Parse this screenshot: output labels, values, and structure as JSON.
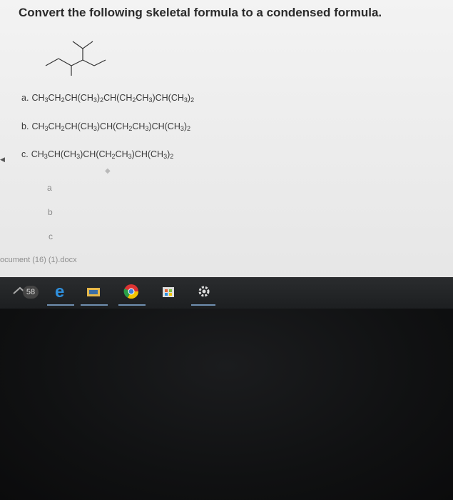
{
  "question": "Convert the following skeletal formula to a condensed formula.",
  "options": [
    {
      "letter": "a.",
      "parts": [
        [
          "CH",
          "3"
        ],
        [
          "CH",
          "2"
        ],
        [
          "CH(CH",
          "3"
        ],
        [
          ")",
          "2"
        ],
        [
          "CH(CH",
          "2"
        ],
        [
          "CH",
          "3"
        ],
        [
          ")CH(CH",
          "3"
        ],
        [
          ")",
          "2"
        ]
      ]
    },
    {
      "letter": "b.",
      "parts": [
        [
          "CH",
          "3"
        ],
        [
          "CH",
          "2"
        ],
        [
          "CH(CH",
          "3"
        ],
        [
          ")CH(CH",
          "2"
        ],
        [
          "CH",
          "3"
        ],
        [
          ")CH(CH",
          "3"
        ],
        [
          ")",
          "2"
        ]
      ]
    },
    {
      "letter": "c.",
      "parts": [
        [
          "CH",
          "3"
        ],
        [
          "CH(CH",
          "3"
        ],
        [
          ")CH(CH",
          "2"
        ],
        [
          "CH",
          "3"
        ],
        [
          ")CH(CH",
          "3"
        ],
        [
          ")",
          "2"
        ]
      ]
    }
  ],
  "answers": [
    "a",
    "b",
    "c"
  ],
  "recent_document": "ocument (16) (1).docx",
  "taskbar": {
    "badge": "58",
    "icons": [
      "task-view-icon",
      "edge-browser-icon",
      "file-explorer-icon",
      "chrome-icon",
      "store-icon",
      "settings-gear-icon"
    ]
  },
  "colors": {
    "screen": "#eeeeee",
    "taskbar": "#1f2123",
    "edge_blue": "#2f8fdc"
  }
}
